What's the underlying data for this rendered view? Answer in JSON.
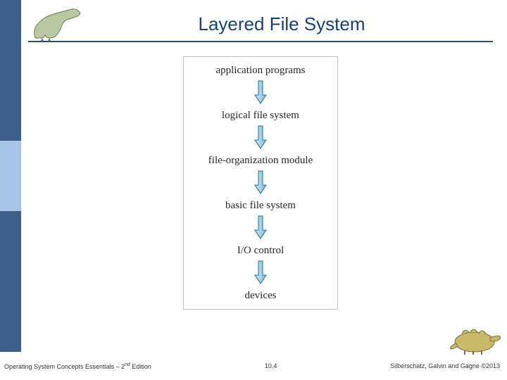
{
  "header": {
    "title": "Layered File System"
  },
  "diagram": {
    "layers": [
      "application programs",
      "logical file system",
      "file-organization module",
      "basic file system",
      "I/O control",
      "devices"
    ]
  },
  "footer": {
    "left_prefix": "Operating System Concepts Essentials – 2",
    "left_sup": "nd",
    "left_suffix": " Edition",
    "center": "10.4",
    "right": "Silberschatz, Galvin and Gagne ©2013"
  },
  "colors": {
    "accent": "#1b4074",
    "arrow_fill": "#7eb8d6",
    "arrow_stroke": "#2b6f92"
  }
}
